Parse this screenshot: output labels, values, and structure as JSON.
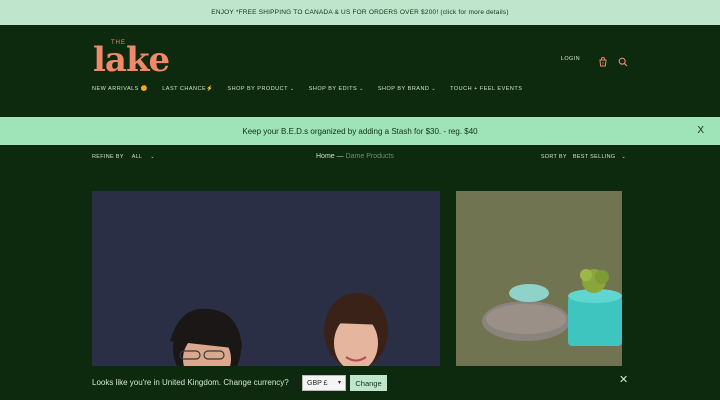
{
  "announcement": "ENJOY *FREE SHIPPING TO CANADA & US FOR ORDERS OVER $200! (click for more details)",
  "brand": {
    "the": "THE",
    "name": "lake"
  },
  "header": {
    "login": "LOGIN"
  },
  "nav": [
    {
      "label": "NEW ARRIVALS 🌼",
      "chevron": false
    },
    {
      "label": "LAST CHANCE⚡",
      "chevron": false
    },
    {
      "label": "SHOP BY PRODUCT",
      "chevron": true
    },
    {
      "label": "SHOP BY EDITS",
      "chevron": true
    },
    {
      "label": "SHOP BY BRAND",
      "chevron": true
    },
    {
      "label": "TOUCH + FEEL EVENTS",
      "chevron": false
    }
  ],
  "promo": {
    "text": "Keep your B.E.D.s organized by adding a Stash for $30. - reg. $40",
    "close": "X"
  },
  "filter": {
    "label": "REFINE BY",
    "value": "ALL"
  },
  "breadcrumb": {
    "home": "Home",
    "sep": "—",
    "current": "Dame Products"
  },
  "sort": {
    "label": "SORT BY",
    "value": "BEST SELLING"
  },
  "currency_bar": {
    "text": "Looks like you're in United Kingdom. Change currency?",
    "selected": "GBP £",
    "button": "Change",
    "close": "✕"
  },
  "colors": {
    "background": "#0d2a0f",
    "accent": "#f0896a",
    "mint": "#9fe3b8"
  }
}
